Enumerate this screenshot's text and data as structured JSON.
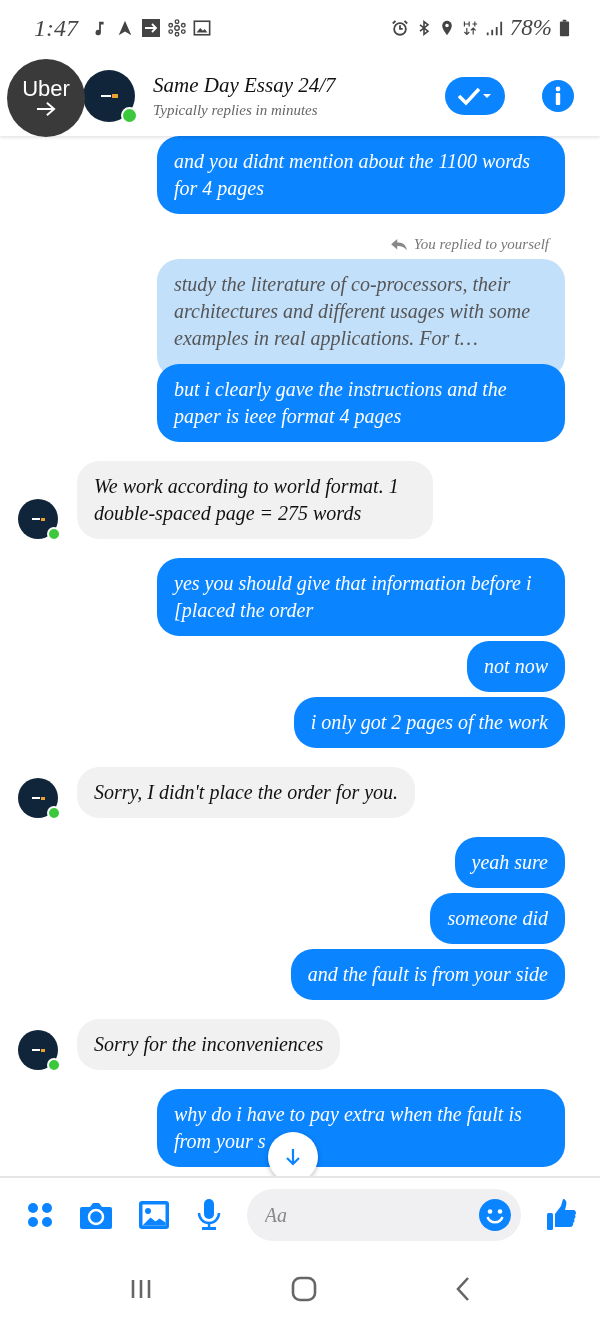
{
  "status_bar": {
    "time": "1:47",
    "battery": "78%"
  },
  "overlay_bubble": {
    "label": "Uber"
  },
  "header": {
    "title": "Same Day Essay 24/7",
    "subtitle": "Typically replies in minutes",
    "online": true
  },
  "messages": [
    {
      "kind": "sent",
      "text": "and you didnt mention about the 1100 words for 4 pages"
    },
    {
      "kind": "reply_note",
      "text": "You replied to yourself"
    },
    {
      "kind": "quoted",
      "text": "study the literature of co-processors, their architectures and different usages with some examples in real applications. For t…"
    },
    {
      "kind": "sent",
      "text": "but i clearly gave the instructions and the paper is ieee format 4 pages"
    },
    {
      "kind": "received",
      "text": "We work according to world format. 1 double-spaced page = 275 words"
    },
    {
      "kind": "sent",
      "text": "yes you should give that information before i [placed the order"
    },
    {
      "kind": "sent",
      "text": "not now"
    },
    {
      "kind": "sent",
      "text": "i only got 2 pages of the work"
    },
    {
      "kind": "received",
      "text": "Sorry, I didn't place the order for you."
    },
    {
      "kind": "sent",
      "text": "yeah sure"
    },
    {
      "kind": "sent",
      "text": "someone did"
    },
    {
      "kind": "sent",
      "text": "and the fault is from your side"
    },
    {
      "kind": "received",
      "text": "Sorry for the inconveniences"
    },
    {
      "kind": "sent",
      "text": "why do i have to pay extra when the fault is from your s"
    }
  ],
  "composer": {
    "placeholder": "Aa"
  }
}
